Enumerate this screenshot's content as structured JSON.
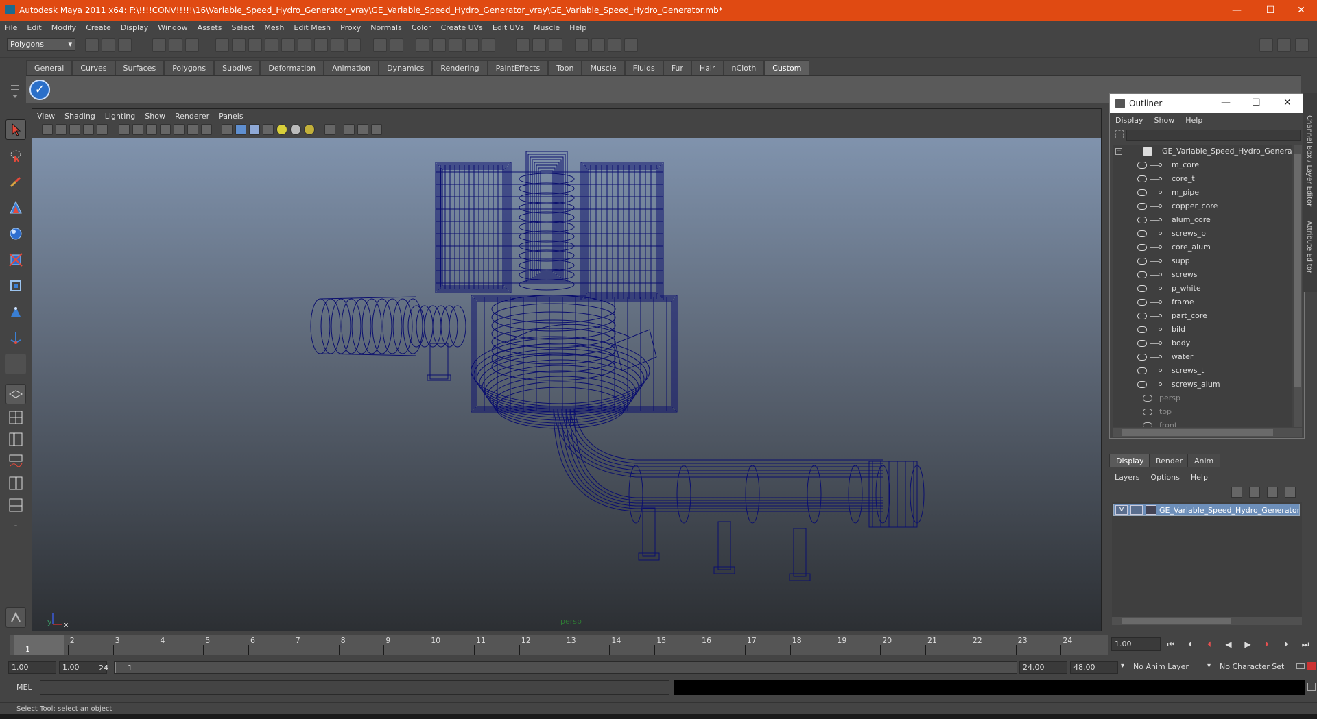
{
  "window": {
    "title": "Autodesk Maya 2011 x64: F:\\!!!!CONV!!!!!\\16\\Variable_Speed_Hydro_Generator_vray\\GE_Variable_Speed_Hydro_Generator_vray\\GE_Variable_Speed_Hydro_Generator.mb*",
    "minimize": "—",
    "maximize": "☐",
    "close": "✕"
  },
  "menubar": [
    "File",
    "Edit",
    "Modify",
    "Create",
    "Display",
    "Window",
    "Assets",
    "Select",
    "Mesh",
    "Edit Mesh",
    "Proxy",
    "Normals",
    "Color",
    "Create UVs",
    "Edit UVs",
    "Muscle",
    "Help"
  ],
  "statusline": {
    "mode": "Polygons"
  },
  "shelf": {
    "tabs": [
      "General",
      "Curves",
      "Surfaces",
      "Polygons",
      "Subdivs",
      "Deformation",
      "Animation",
      "Dynamics",
      "Rendering",
      "PaintEffects",
      "Toon",
      "Muscle",
      "Fluids",
      "Fur",
      "Hair",
      "nCloth",
      "Custom"
    ],
    "active_tab": "Custom",
    "button_glyph": "✓"
  },
  "viewport": {
    "menu": [
      "View",
      "Shading",
      "Lighting",
      "Show",
      "Renderer",
      "Panels"
    ],
    "camera": "persp",
    "axis_x": "x",
    "axis_y": "y",
    "wire_color": "#0b0f6e"
  },
  "outliner": {
    "title": "Outliner",
    "menu": [
      "Display",
      "Show",
      "Help"
    ],
    "root": "GE_Variable_Speed_Hydro_Generator",
    "children": [
      "m_core",
      "core_t",
      "m_pipe",
      "copper_core",
      "alum_core",
      "screws_p",
      "core_alum",
      "supp",
      "screws",
      "p_white",
      "frame",
      "part_core",
      "bild",
      "body",
      "water",
      "screws_t",
      "screws_alum"
    ],
    "cameras": [
      "persp",
      "top",
      "front"
    ]
  },
  "layer_editor": {
    "tabs": [
      "Display",
      "Render",
      "Anim"
    ],
    "active_tab": "Display",
    "menu": [
      "Layers",
      "Options",
      "Help"
    ],
    "layer_visible": "V",
    "layer_name": "GE_Variable_Speed_Hydro_Generator_layer"
  },
  "side_tabs": [
    "Channel Box / Layer Editor",
    "Attribute Editor"
  ],
  "time": {
    "ticks": [
      "1",
      "2",
      "3",
      "4",
      "5",
      "6",
      "7",
      "8",
      "9",
      "10",
      "11",
      "12",
      "13",
      "14",
      "15",
      "16",
      "17",
      "18",
      "19",
      "20",
      "21",
      "22",
      "23",
      "24"
    ],
    "current_frame_marker": "1",
    "current_time": "1.00",
    "playback_start": "1.00",
    "range_start": "1.00",
    "range_slider_start": "1",
    "range_slider_end": "24",
    "range_end": "24.00",
    "playback_end": "48.00",
    "anim_layer": "No Anim Layer",
    "character_set": "No Character Set"
  },
  "command": {
    "label": "MEL"
  },
  "help_line": "Select Tool: select an object"
}
